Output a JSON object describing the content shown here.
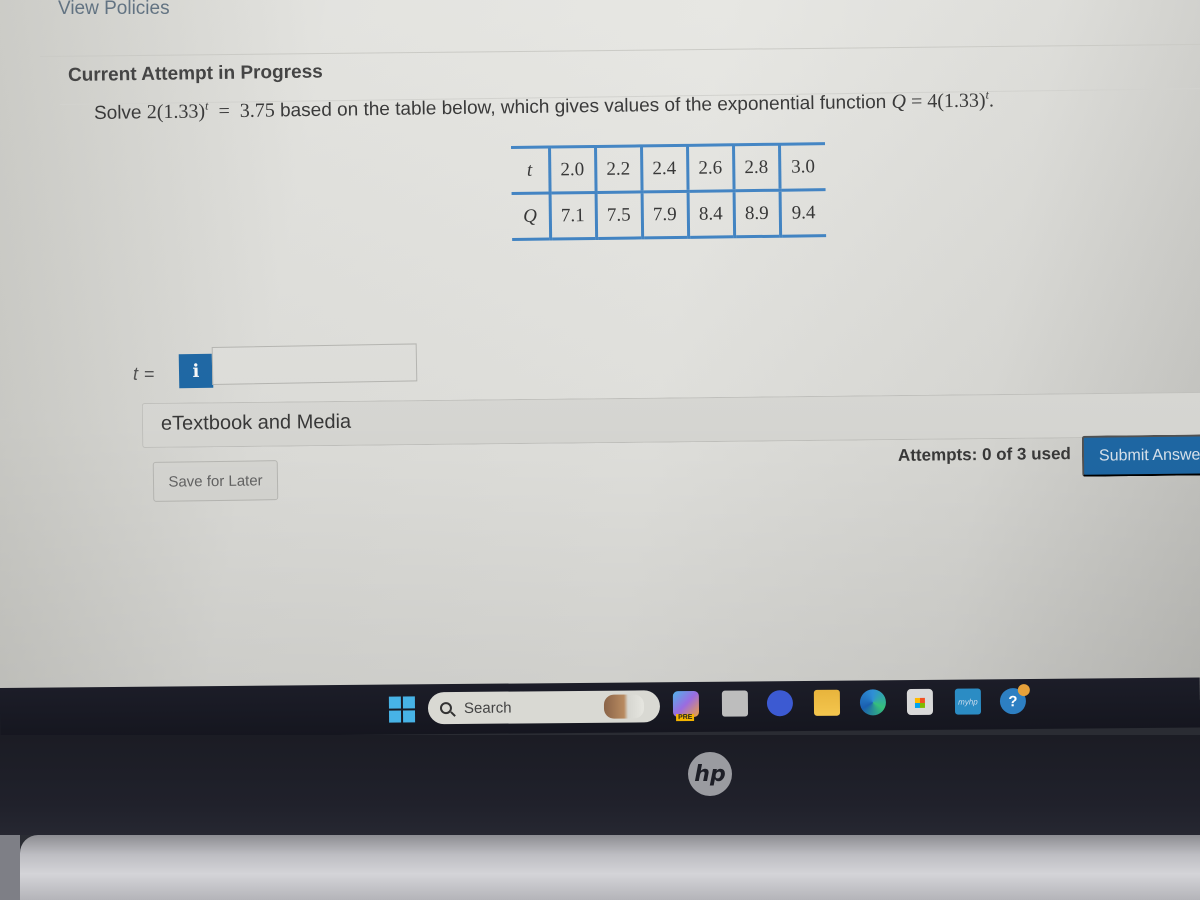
{
  "header": {
    "view_policies": "View Policies",
    "attempt_title": "Current Attempt in Progress"
  },
  "question": {
    "prefix": "Solve",
    "equation_lhs": "2(1.33)",
    "equation_exp": "t",
    "equation_eq": "=",
    "equation_rhs": "3.75",
    "middle_text": "based on the table below, which gives values of the exponential function",
    "function_var": "Q",
    "function_eq": "=",
    "function_rhs": "4(1.33)",
    "function_exp": "t",
    "suffix": "."
  },
  "table": {
    "row_t": {
      "label": "t",
      "values": [
        "2.0",
        "2.2",
        "2.4",
        "2.6",
        "2.8",
        "3.0"
      ]
    },
    "row_q": {
      "label": "Q",
      "values": [
        "7.1",
        "7.5",
        "7.9",
        "8.4",
        "8.9",
        "9.4"
      ]
    }
  },
  "answer": {
    "label_var": "t",
    "label_eq": "=",
    "info_glyph": "i",
    "input_value": ""
  },
  "etextbook": {
    "label": "eTextbook and Media"
  },
  "footer": {
    "save_later": "Save for Later",
    "attempts": "Attempts: 0 of 3 used",
    "submit": "Submit Answer"
  },
  "taskbar": {
    "search_label": "Search",
    "copilot_badge": "PRE",
    "myhp_label": "myhp",
    "help_glyph": "?"
  },
  "bezel": {
    "logo": "hp"
  },
  "colors": {
    "accent_blue": "#1f6aa8",
    "table_border": "#3f83c4",
    "link": "#5a6c7c"
  }
}
